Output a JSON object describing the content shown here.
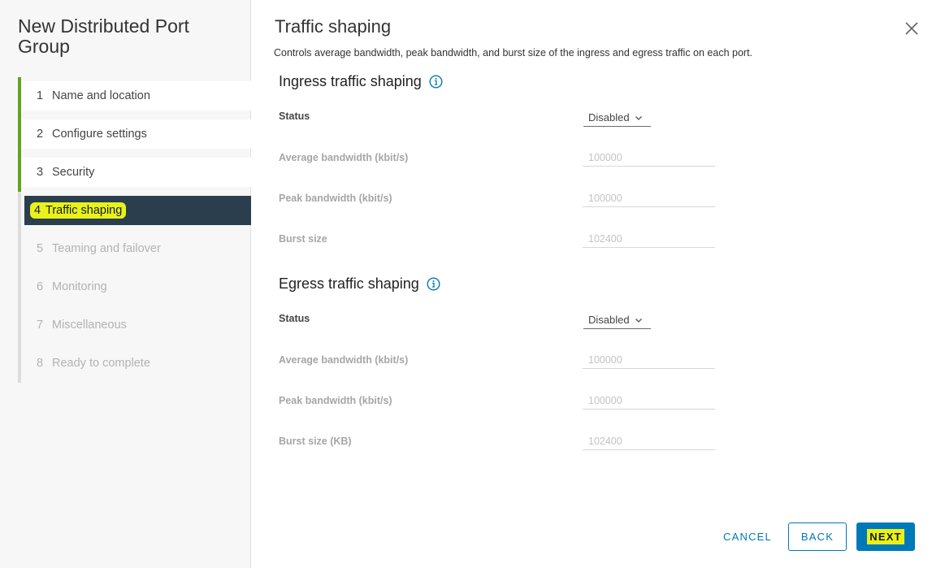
{
  "wizard": {
    "title": "New Distributed Port Group"
  },
  "steps": [
    {
      "num": "1",
      "label": "Name and location",
      "state": "done"
    },
    {
      "num": "2",
      "label": "Configure settings",
      "state": "done"
    },
    {
      "num": "3",
      "label": "Security",
      "state": "done"
    },
    {
      "num": "4",
      "label": "Traffic shaping",
      "state": "active"
    },
    {
      "num": "5",
      "label": "Teaming and failover",
      "state": "pending"
    },
    {
      "num": "6",
      "label": "Monitoring",
      "state": "pending"
    },
    {
      "num": "7",
      "label": "Miscellaneous",
      "state": "pending"
    },
    {
      "num": "8",
      "label": "Ready to complete",
      "state": "pending"
    }
  ],
  "page": {
    "title": "Traffic shaping",
    "description": "Controls average bandwidth, peak bandwidth, and burst size of the ingress and egress traffic on each port."
  },
  "ingress": {
    "title": "Ingress traffic shaping",
    "status_label": "Status",
    "status_value": "Disabled",
    "avg_label": "Average bandwidth (kbit/s)",
    "avg_placeholder": "100000",
    "peak_label": "Peak bandwidth (kbit/s)",
    "peak_placeholder": "100000",
    "burst_label": "Burst size",
    "burst_placeholder": "102400"
  },
  "egress": {
    "title": "Egress traffic shaping",
    "status_label": "Status",
    "status_value": "Disabled",
    "avg_label": "Average bandwidth (kbit/s)",
    "avg_placeholder": "100000",
    "peak_label": "Peak bandwidth (kbit/s)",
    "peak_placeholder": "100000",
    "burst_label": "Burst size (KB)",
    "burst_placeholder": "102400"
  },
  "footer": {
    "cancel_label": "CANCEL",
    "back_label": "BACK",
    "next_label": "NEXT"
  },
  "colors": {
    "accent": "#0079b8",
    "done_bar": "#62a420",
    "active_bg": "#2b3e4d",
    "highlight": "#e8f21a"
  }
}
